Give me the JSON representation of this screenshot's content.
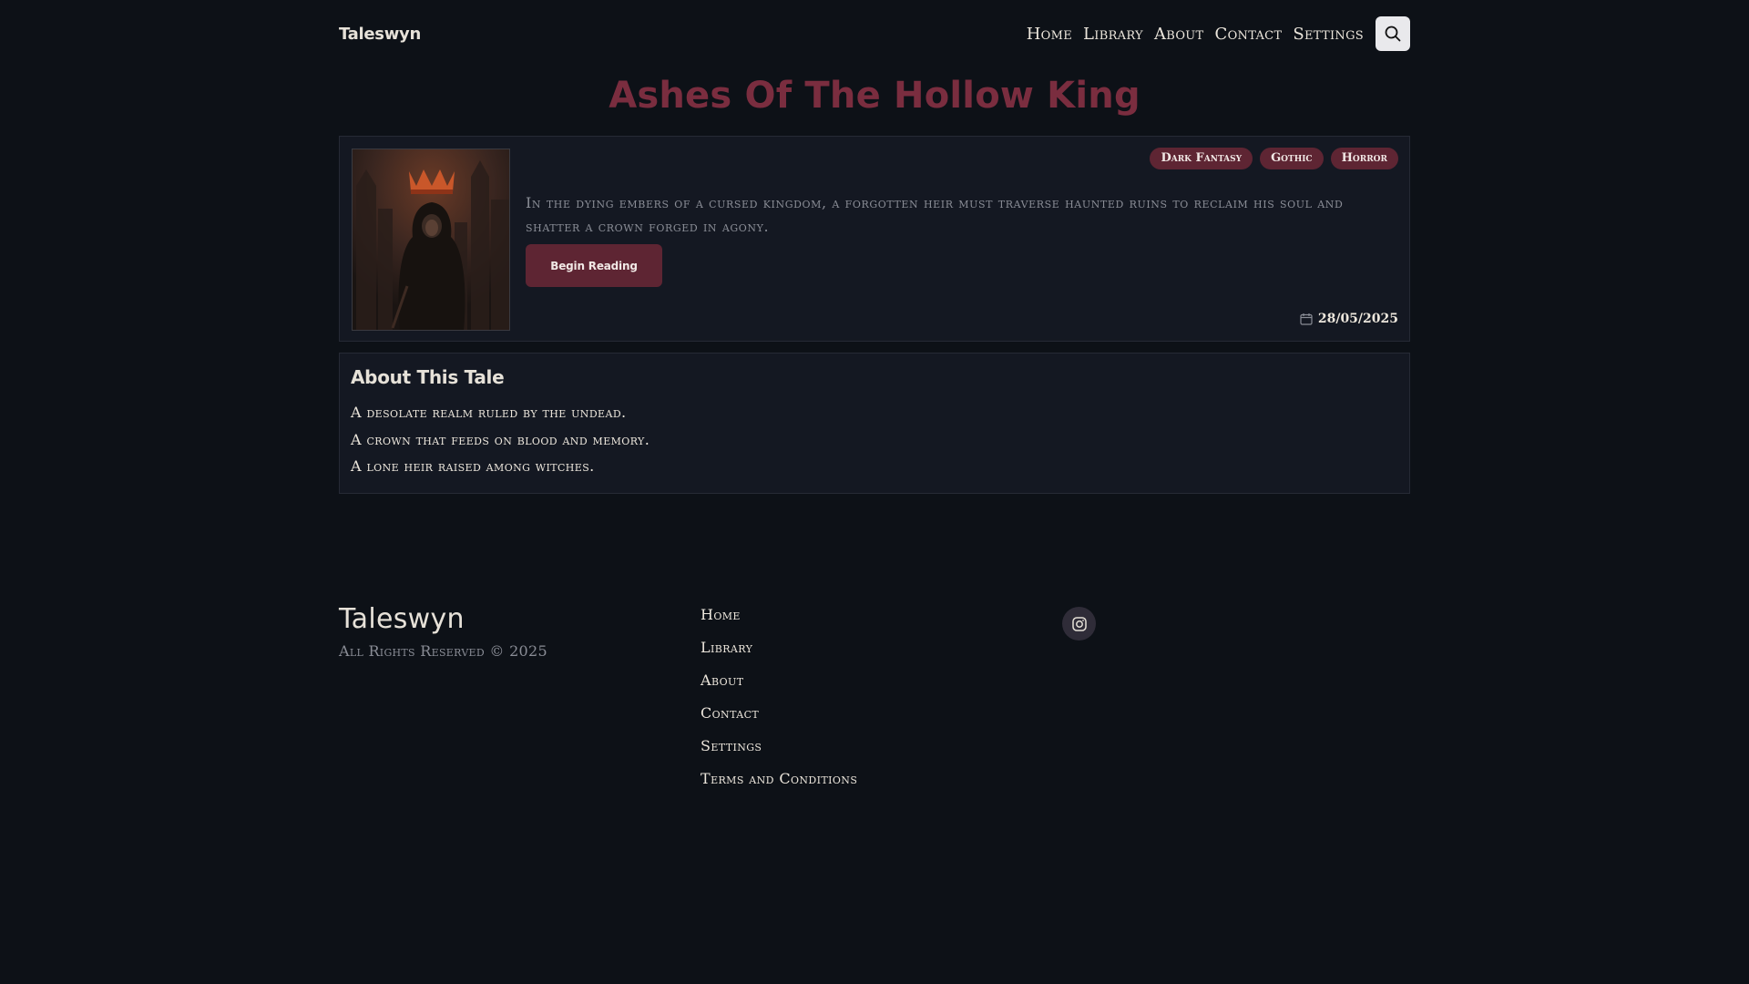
{
  "header": {
    "logo": "Taleswyn",
    "nav": [
      "Home",
      "Library",
      "About",
      "Contact",
      "Settings"
    ],
    "search_icon": "search-icon"
  },
  "story": {
    "title": "Ashes Of The Hollow King",
    "tags": [
      "Dark Fantasy",
      "Gothic",
      "Horror"
    ],
    "synopsis": "In the dying embers of a cursed kingdom, a forgotten heir must traverse haunted ruins to reclaim his soul and shatter a crown forged in agony.",
    "read_button": "Begin Reading",
    "date": "28/05/2025",
    "date_icon": "calendar-icon"
  },
  "about": {
    "heading": "About This Tale",
    "lines": [
      "A desolate realm ruled by the undead.",
      "A crown that feeds on blood and memory.",
      "A lone heir raised among witches."
    ]
  },
  "footer": {
    "brand": "Taleswyn",
    "copyright": "All Rights Reserved © 2025",
    "links": [
      "Home",
      "Library",
      "About",
      "Contact",
      "Settings",
      "Terms and Conditions"
    ],
    "social_icon": "instagram-icon"
  },
  "colors": {
    "background": "#0d1117",
    "card": "#141822",
    "accent": "#5e2533",
    "title": "#7a2d3f"
  }
}
